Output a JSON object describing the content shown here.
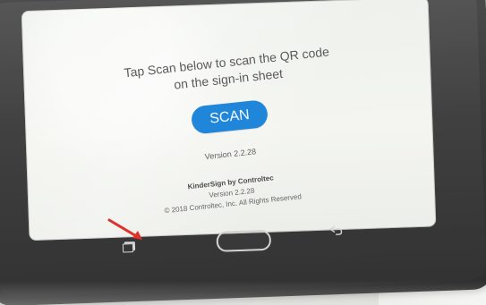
{
  "screen": {
    "instruction": "Tap Scan below to scan the QR code\non the sign-in sheet",
    "scan_button": "SCAN",
    "version_top": "Version 2.2.28",
    "brand_line": "KinderSign by Controltec",
    "version_footer": "Version 2.2.28",
    "copyright_line": "© 2018 Controltec, Inc. All Rights Reserved"
  },
  "icons": {
    "recent": "recent-apps-icon",
    "home": "home-button",
    "back": "back-icon",
    "arrow": "red-arrow-icon"
  },
  "colors": {
    "scan_button": "#1f86da",
    "arrow": "#e0302a"
  }
}
